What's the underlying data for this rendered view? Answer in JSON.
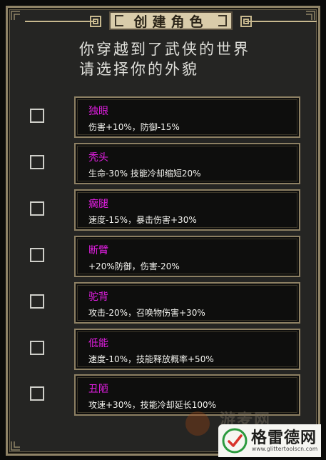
{
  "title": "创建角色",
  "intro": {
    "line1": "你穿越到了武侠的世界",
    "line2": "请选择你的外貌"
  },
  "traits": [
    {
      "name": "独眼",
      "effect": "伤害+10%，防御-15%",
      "checked": false
    },
    {
      "name": "秃头",
      "effect": "生命-30%  技能冷却缩短20%",
      "checked": false
    },
    {
      "name": "瘸腿",
      "effect": "速度-15%，暴击伤害+30%",
      "checked": false
    },
    {
      "name": "断臂",
      "effect": "+20%防御，伤害-20%",
      "checked": false
    },
    {
      "name": "驼背",
      "effect": "攻击-20%，召唤物伤害+30%",
      "checked": false
    },
    {
      "name": "低能",
      "effect": "速度-10%，技能释放概率+50%",
      "checked": false
    },
    {
      "name": "丑陋",
      "effect": "攻速+30%，技能冷却延长100%",
      "checked": false
    }
  ],
  "colors": {
    "trait_name": "#e11ee1",
    "frame_border": "#8f8366",
    "panel_bg": "#252523",
    "card_bg": "#0e0e0d"
  },
  "watermark": {
    "ghost_text": "游麦网",
    "brand": "格雷德网",
    "url": "www.glittertoolscn.com",
    "logo_icon": "leaf-check-icon"
  }
}
